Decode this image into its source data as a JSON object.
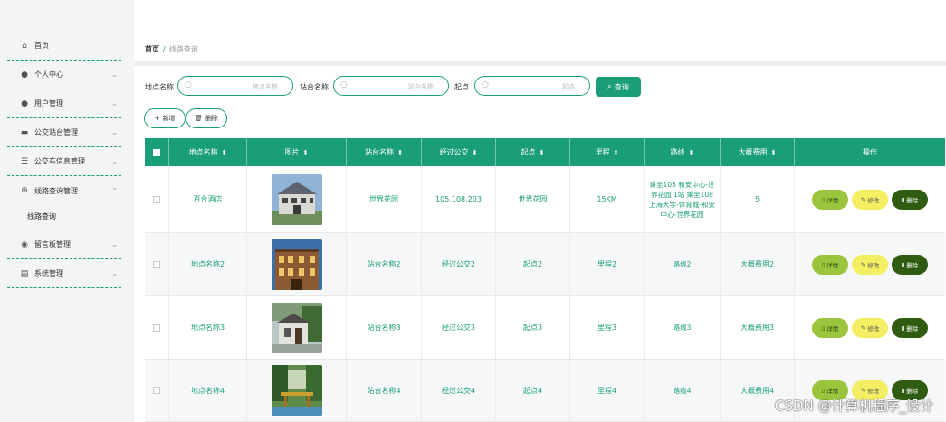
{
  "sidebar": {
    "items": [
      {
        "icon": "home-icon",
        "glyph": "⌂",
        "label": "首页",
        "chevron": ""
      },
      {
        "icon": "user-icon",
        "glyph": "👤",
        "label": "个人中心",
        "chevron": "⌄"
      },
      {
        "icon": "users-icon",
        "glyph": "👥",
        "label": "用户管理",
        "chevron": "⌄"
      },
      {
        "icon": "monitor-icon",
        "glyph": "▭",
        "label": "公交站台管理",
        "chevron": "⌄"
      },
      {
        "icon": "list-icon",
        "glyph": "☰",
        "label": "公交车信息管理",
        "chevron": "⌄"
      },
      {
        "icon": "globe-icon",
        "glyph": "⊕",
        "label": "线路查询管理",
        "chevron": "⌃"
      },
      {
        "icon": "pin-icon",
        "glyph": "📍",
        "label": "留言板管理",
        "chevron": "⌄"
      },
      {
        "icon": "clipboard-icon",
        "glyph": "▤",
        "label": "系统管理",
        "chevron": "⌄"
      }
    ],
    "sub_item": "线路查询"
  },
  "breadcrumb": {
    "home": "首页",
    "sep": "/",
    "current": "线路查询"
  },
  "search": {
    "fields": [
      {
        "label": "地点名称",
        "placeholder": "地点名称"
      },
      {
        "label": "站台名称",
        "placeholder": "站台名称"
      },
      {
        "label": "起点",
        "placeholder": "起点"
      }
    ],
    "button": "查询"
  },
  "actions": {
    "add": "新增",
    "delete": "删除"
  },
  "table": {
    "headers": [
      "地点名称",
      "图片",
      "站台名称",
      "经过公交",
      "起点",
      "里程",
      "路线",
      "大概费用",
      "操作"
    ],
    "rows": [
      {
        "place": "百合酒店",
        "station": "世界花园",
        "bus": "105,108,203",
        "start": "世界花园",
        "mileage": "15KM",
        "route": "乘坐105 和安中心-世界花园 1站 乘坐108 上海大学-体育城-和安中心-世界花园",
        "cost": "5"
      },
      {
        "place": "地点名称2",
        "station": "站台名称2",
        "bus": "经过公交2",
        "start": "起点2",
        "mileage": "里程2",
        "route": "路线2",
        "cost": "大概费用2"
      },
      {
        "place": "地点名称3",
        "station": "站台名称3",
        "bus": "经过公交3",
        "start": "起点3",
        "mileage": "里程3",
        "route": "路线3",
        "cost": "大概费用3"
      },
      {
        "place": "地点名称4",
        "station": "站台名称4",
        "bus": "经过公交4",
        "start": "起点4",
        "mileage": "里程4",
        "route": "路线4",
        "cost": "大概费用4"
      }
    ],
    "ops": {
      "detail": "详情",
      "edit": "修改",
      "delete": "删除"
    }
  },
  "watermark": "CSDN @计算机程序_设计",
  "colors": {
    "accent": "#1a9e78",
    "detail": "#9bc53d",
    "edit": "#f3ee62",
    "delete": "#2f5c10"
  }
}
